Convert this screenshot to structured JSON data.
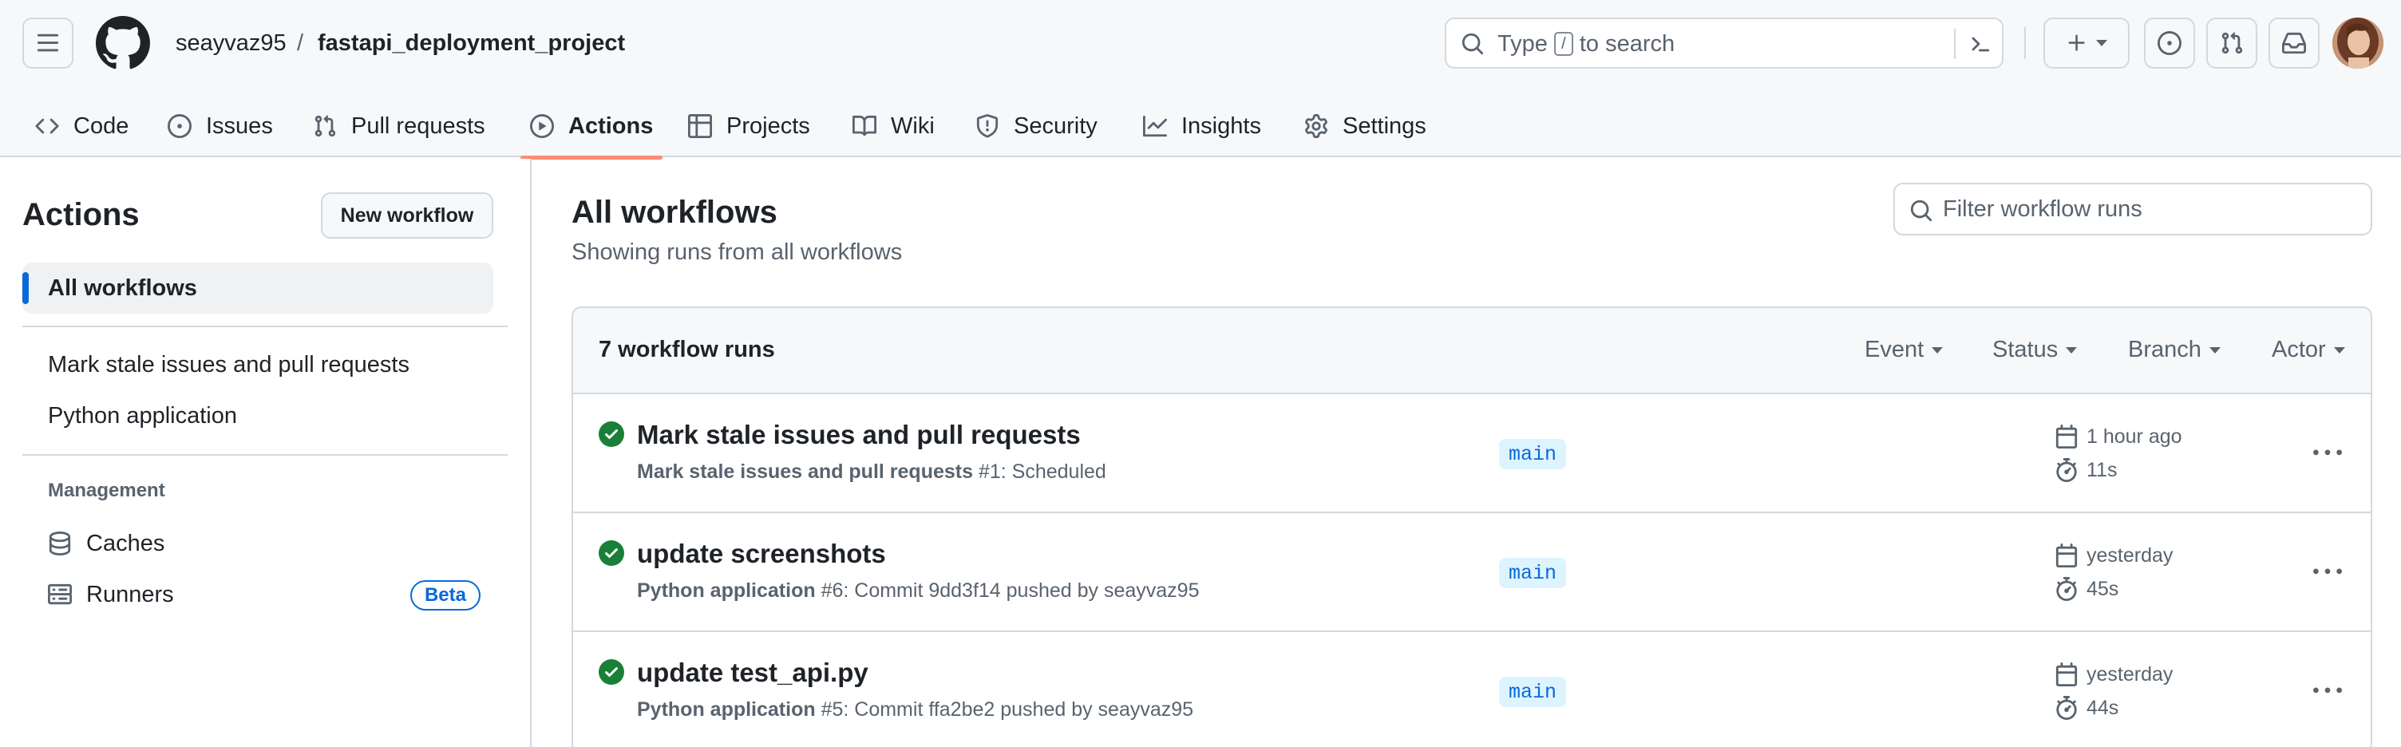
{
  "header": {
    "owner": "seayvaz95",
    "separator": "/",
    "repo": "fastapi_deployment_project",
    "search": {
      "prefix": "Type",
      "key": "/",
      "suffix": "to search"
    }
  },
  "repo_tabs": [
    {
      "label": "Code",
      "icon": "code-icon"
    },
    {
      "label": "Issues",
      "icon": "issue-opened-icon"
    },
    {
      "label": "Pull requests",
      "icon": "git-pull-request-icon"
    },
    {
      "label": "Actions",
      "icon": "play-icon",
      "active": true
    },
    {
      "label": "Projects",
      "icon": "table-icon"
    },
    {
      "label": "Wiki",
      "icon": "book-icon"
    },
    {
      "label": "Security",
      "icon": "shield-icon"
    },
    {
      "label": "Insights",
      "icon": "graph-icon"
    },
    {
      "label": "Settings",
      "icon": "gear-icon"
    }
  ],
  "sidebar": {
    "title": "Actions",
    "new_workflow": "New workflow",
    "items": [
      {
        "label": "All workflows",
        "active": true
      },
      {
        "label": "Mark stale issues and pull requests"
      },
      {
        "label": "Python application"
      }
    ],
    "management_heading": "Management",
    "management": [
      {
        "label": "Caches",
        "icon": "database-icon"
      },
      {
        "label": "Runners",
        "icon": "server-icon",
        "badge": "Beta"
      }
    ]
  },
  "main": {
    "title": "All workflows",
    "subtitle": "Showing runs from all workflows",
    "filter_placeholder": "Filter workflow runs",
    "runs_count": "7 workflow runs",
    "filters": [
      "Event",
      "Status",
      "Branch",
      "Actor"
    ],
    "runs": [
      {
        "title": "Mark stale issues and pull requests",
        "workflow": "Mark stale issues and pull requests",
        "detail": "#1: Scheduled",
        "branch": "main",
        "when": "1 hour ago",
        "duration": "11s",
        "status": "success"
      },
      {
        "title": "update screenshots",
        "workflow": "Python application",
        "detail": "#6: Commit 9dd3f14 pushed by seayvaz95",
        "branch": "main",
        "when": "yesterday",
        "duration": "45s",
        "status": "success"
      },
      {
        "title": "update test_api.py",
        "workflow": "Python application",
        "detail": "#5: Commit ffa2be2 pushed by seayvaz95",
        "branch": "main",
        "when": "yesterday",
        "duration": "44s",
        "status": "success"
      }
    ]
  },
  "colors": {
    "accent": "#0969da",
    "success": "#1a7f37",
    "active_tab_underline": "#fd8c73",
    "header_bg": "#f6f8fa",
    "border": "#d1d9e0"
  }
}
